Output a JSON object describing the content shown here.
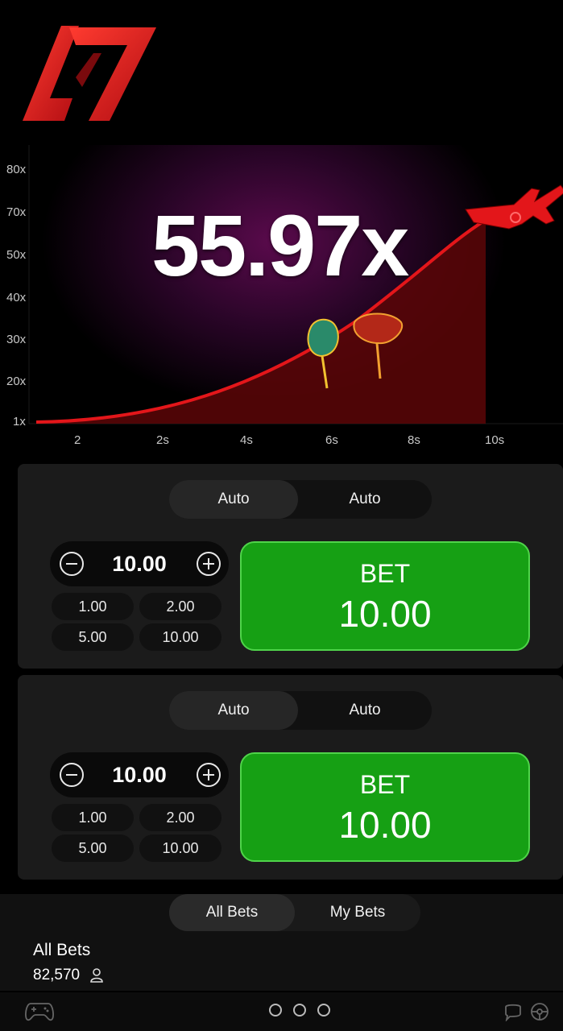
{
  "colors": {
    "brand_red": "#e4151b",
    "curve_red": "#e3161a",
    "bet_green": "#16a014",
    "panel_bg": "#1b1b1b"
  },
  "logo": {
    "icon": "brand-logo-icon"
  },
  "game": {
    "multiplier": "55.97x",
    "y_axis": [
      "80x",
      "70x",
      "50x",
      "40x",
      "30x",
      "20x",
      "1x"
    ],
    "x_axis": [
      "2",
      "2s",
      "4s",
      "6s",
      "8s",
      "10s"
    ],
    "plane_icon": "airplane-icon",
    "flowers_icon": "mushroom-flowers-icon"
  },
  "panel1": {
    "tabs": [
      "Auto",
      "Auto"
    ],
    "amount": "10.00",
    "quick_amounts": [
      "1.00",
      "2.00",
      "5.00",
      "10.00"
    ],
    "bet_label": "BET",
    "bet_amount": "10.00"
  },
  "panel2": {
    "tabs": [
      "Auto",
      "Auto"
    ],
    "amount": "10.00",
    "quick_amounts": [
      "1.00",
      "2.00",
      "5.00",
      "10.00"
    ],
    "bet_label": "BET",
    "bet_amount": "10.00"
  },
  "bets": {
    "tabs": [
      "All Bets",
      "My Bets"
    ],
    "title": "All Bets",
    "count": "82,570"
  },
  "bottom_bar": {
    "left_icon": "gamepad-icon",
    "right_icons": [
      "chat-icon",
      "steering-wheel-icon"
    ]
  }
}
